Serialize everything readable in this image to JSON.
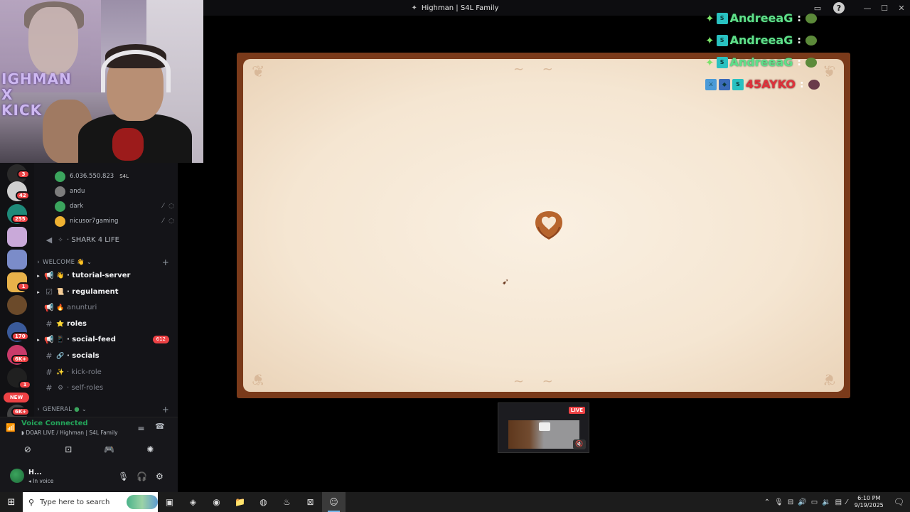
{
  "window": {
    "title": "Highman | S4L Family",
    "title_icon": "shark-icon",
    "controls": [
      "—",
      "☐",
      "✕"
    ]
  },
  "webcam": {
    "overlay_text": "IGHMAN\nX\nKICK"
  },
  "servers": [
    {
      "badge": "3"
    },
    {
      "badge": "42"
    },
    {
      "badge": "255"
    },
    {
      "badge": ""
    },
    {
      "badge": ""
    },
    {
      "badge": "1"
    },
    {
      "badge": ""
    },
    {
      "badge": "170"
    },
    {
      "badge": "6K+"
    },
    {
      "badge": "1"
    },
    {
      "badge": "6K+"
    }
  ],
  "new_badge": "NEW",
  "voice_users": [
    {
      "name": "6.036.550.823",
      "tag": "S4L",
      "icons": "",
      "color": "#3ba55d"
    },
    {
      "name": "andu",
      "tag": "",
      "icons": "",
      "color": "#7d7d7d"
    },
    {
      "name": "dark",
      "tag": "",
      "icons": "⁄⃠ ◌",
      "color": "#3ba55d"
    },
    {
      "name": "nicusor7gaming",
      "tag": "",
      "icons": "⁄⃠ ◌",
      "color": "#f0b232"
    }
  ],
  "channels": {
    "shark_voice": "SHARK 4 LIFE",
    "category_welcome": "WELCOME ",
    "category_general": "GENERAL ",
    "items": [
      {
        "name": "tutorial-server",
        "emoji": "👋",
        "bold": true,
        "count": ""
      },
      {
        "name": "regulament",
        "emoji": "📜",
        "bold": true,
        "count": ""
      },
      {
        "name": "anunturi",
        "emoji": "🔥",
        "bold": false,
        "count": ""
      },
      {
        "name": "roles",
        "emoji": "⭐",
        "bold": true,
        "count": ""
      },
      {
        "name": "social-feed",
        "emoji": "📱",
        "bold": true,
        "count": "612"
      },
      {
        "name": "socials",
        "emoji": "🔗",
        "bold": true,
        "count": ""
      },
      {
        "name": "kick-role",
        "emoji": "✨",
        "bold": false,
        "count": ""
      },
      {
        "name": "self-roles",
        "emoji": "⚙",
        "bold": false,
        "count": ""
      }
    ]
  },
  "voice_panel": {
    "status": "Voice Connected",
    "location": "DOAR LIVE / Highman | S4L Family",
    "user_name": "H...",
    "user_status": "In voice"
  },
  "chat": [
    {
      "name": "AndreeaG",
      "color": "#5fe08a"
    },
    {
      "name": "AndreeaG",
      "color": "#5fe08a"
    },
    {
      "name": "AndreeaG",
      "color": "#5fe08a"
    },
    {
      "name": "45AYKO",
      "color": "#e0303a"
    }
  ],
  "mini_preview": {
    "live_label": "LIVE"
  },
  "taskbar": {
    "search_placeholder": "Type here to search",
    "time": "6:10 PM",
    "date": "9/19/2025"
  }
}
